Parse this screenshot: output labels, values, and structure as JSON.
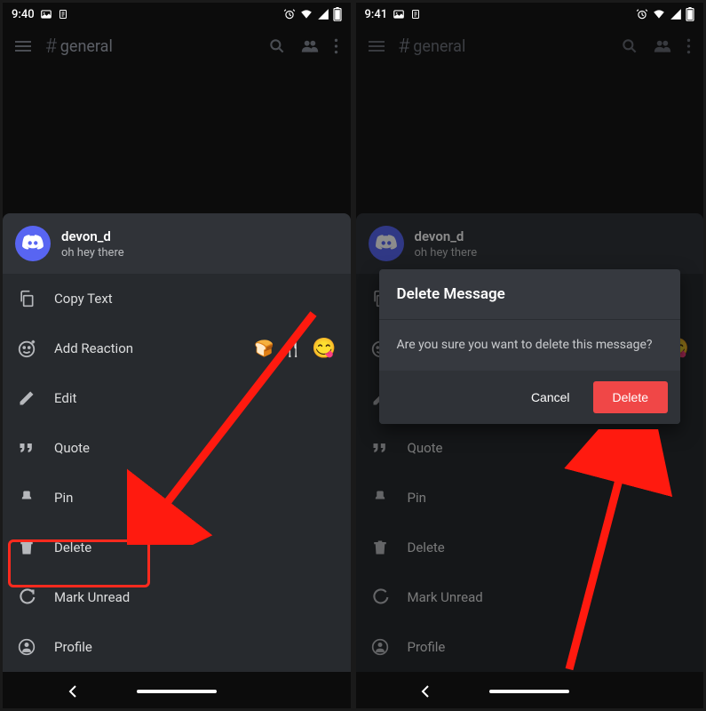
{
  "status": {
    "time1": "9:40",
    "time2": "9:41"
  },
  "topbar": {
    "channel": "general"
  },
  "message": {
    "user": "devon_d",
    "text": "oh hey there"
  },
  "menu": {
    "copy": "Copy Text",
    "react": "Add Reaction",
    "edit": "Edit",
    "quote": "Quote",
    "pin": "Pin",
    "delete": "Delete",
    "unread": "Mark Unread",
    "profile": "Profile",
    "emoji_bread": "🍞",
    "emoji_fork": "🍴",
    "emoji_yum": "😋"
  },
  "dialog": {
    "title": "Delete Message",
    "body": "Are you sure you want to delete this message?",
    "cancel": "Cancel",
    "delete": "Delete"
  }
}
